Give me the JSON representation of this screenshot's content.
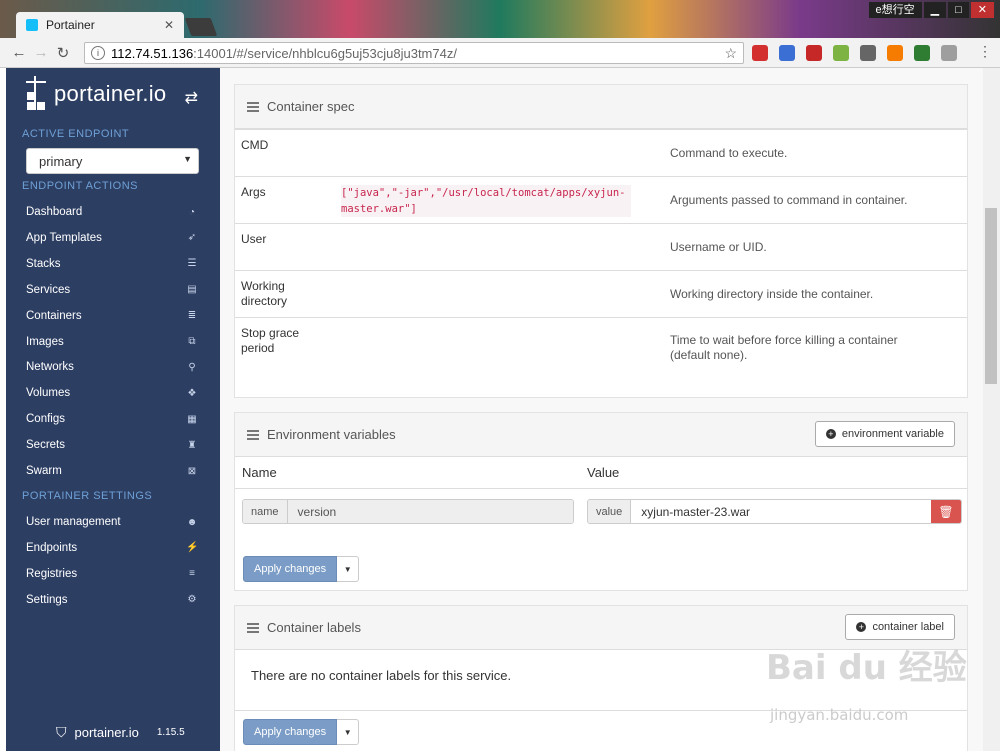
{
  "browser": {
    "tab_title": "Portainer",
    "tab_close": "✕",
    "window_label": "e想行空",
    "url_host": "112.74.51.136",
    "url_path": ":14001/#/service/nhblcu6g5uj53cju8ju3tm74z/",
    "extensions": [
      {
        "name": "ext-red-icon",
        "color": "#d32f2f"
      },
      {
        "name": "ext-translate-icon",
        "color": "#3b6fd4"
      },
      {
        "name": "ext-adblock-icon",
        "color": "#c62828"
      },
      {
        "name": "ext-green-circle-icon",
        "color": "#7cb342"
      },
      {
        "name": "ext-gray-icon",
        "color": "#666666"
      },
      {
        "name": "ext-orange-icon",
        "color": "#f57c00"
      },
      {
        "name": "ext-green-square-icon",
        "color": "#2e7d32"
      },
      {
        "name": "ext-cloud-icon",
        "color": "#9e9e9e"
      }
    ]
  },
  "sidebar": {
    "logo_text": "portainer.io",
    "active_endpoint_title": "ACTIVE ENDPOINT",
    "endpoint_value": "primary",
    "endpoint_actions_title": "ENDPOINT ACTIONS",
    "endpoint_items": [
      {
        "label": "Dashboard",
        "icon": "tachometer-icon",
        "glyph": "◔"
      },
      {
        "label": "App Templates",
        "icon": "rocket-icon",
        "glyph": "➶"
      },
      {
        "label": "Stacks",
        "icon": "list-icon",
        "glyph": "☰"
      },
      {
        "label": "Services",
        "icon": "list-alt-icon",
        "glyph": "▤"
      },
      {
        "label": "Containers",
        "icon": "server-icon",
        "glyph": "≣"
      },
      {
        "label": "Images",
        "icon": "clone-icon",
        "glyph": "⧉"
      },
      {
        "label": "Networks",
        "icon": "sitemap-icon",
        "glyph": "⚲"
      },
      {
        "label": "Volumes",
        "icon": "cubes-icon",
        "glyph": "❖"
      },
      {
        "label": "Configs",
        "icon": "file-code-icon",
        "glyph": "▦"
      },
      {
        "label": "Secrets",
        "icon": "user-secret-icon",
        "glyph": "♜"
      },
      {
        "label": "Swarm",
        "icon": "object-group-icon",
        "glyph": "⊠"
      }
    ],
    "portainer_settings_title": "PORTAINER SETTINGS",
    "settings_items": [
      {
        "label": "User management",
        "icon": "users-icon",
        "glyph": "☻"
      },
      {
        "label": "Endpoints",
        "icon": "plug-icon",
        "glyph": "⚡"
      },
      {
        "label": "Registries",
        "icon": "database-icon",
        "glyph": "≡"
      },
      {
        "label": "Settings",
        "icon": "cogs-icon",
        "glyph": "⚙"
      }
    ],
    "footer_logo": "portainer.io",
    "version": "1.15.5"
  },
  "container_spec": {
    "title": "Container spec",
    "rows": [
      {
        "label": "CMD",
        "value": "",
        "desc": "Command to execute."
      },
      {
        "label": "Args",
        "value": "[\"java\",\"-jar\",\"/usr/local/tomcat/apps/xyjun-master.war\"]",
        "desc": "Arguments passed to command in container."
      },
      {
        "label": "User",
        "value": "",
        "desc": "Username or UID."
      },
      {
        "label": "Working directory",
        "value": "",
        "desc": "Working directory inside the container."
      },
      {
        "label": "Stop grace period",
        "value": "",
        "desc": "Time to wait before force killing a container (default none)."
      }
    ]
  },
  "env_vars": {
    "title": "Environment variables",
    "add_button": "environment variable",
    "col_name": "Name",
    "col_value": "Value",
    "name_addon": "name",
    "name_value": "version",
    "value_addon": "value",
    "value_value": "xyjun-master-23.war",
    "apply_button": "Apply changes"
  },
  "container_labels": {
    "title": "Container labels",
    "add_button": "container label",
    "empty_text": "There are no container labels for this service.",
    "apply_button": "Apply changes"
  },
  "watermark": {
    "main": "Bai du 经验",
    "sub": "jingyan.baidu.com"
  }
}
